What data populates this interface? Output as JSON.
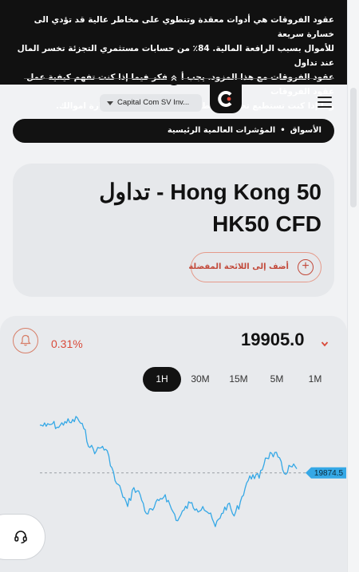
{
  "risk_warning": {
    "lines": [
      "عقود الفروقات هي أدوات معقدة وتنطوي على مخاطر عالية قد تؤدي الى خسارة سريعة",
      "للأموال بسبب الرافعة المالية. 84٪ من حسابات مستثمري التجزئة تخسر المال عند تداول",
      "عقود الفروقات مع هذا المزود. يجب أن تفكر فيما إذا كنت تفهم كيفية عمل عقود الفروقات",
      "وما إذا كنت تستطيع تحمل مخاطر عالية قد تؤدي الى خسارة اموالك."
    ],
    "collapse_icon": "double-chevron-up-icon"
  },
  "header": {
    "account_label": "Capital Com SV Inv...",
    "logo_icon": "capital-com-logo",
    "menu_icon": "hamburger-menu-icon"
  },
  "breadcrumb": {
    "items": [
      "الأسواق",
      "المؤشرات العالمية الرئيسية"
    ],
    "separator": "•"
  },
  "instrument": {
    "title_line1": "تداول - Hong Kong 50",
    "title_line2": "HK50 CFD",
    "favorite_label": "أضف إلى اللائحة المفضلة"
  },
  "quote": {
    "price": "19905.0",
    "change": "0.31%",
    "timeframes": [
      "1H",
      "30M",
      "15M",
      "5M",
      "1M"
    ],
    "active_timeframe": "1H",
    "colors": {
      "down": "#d94a3a",
      "line": "#35a8e6",
      "accent": "#c2493a"
    }
  },
  "chart_data": {
    "type": "line",
    "reference_label": "19874.5",
    "series": [
      {
        "values": [
          19915,
          19914,
          19916,
          19913,
          19918,
          19917,
          19921,
          19912,
          19896,
          19893,
          19897,
          19889,
          19868,
          19859,
          19846,
          19862,
          19856,
          19840,
          19843,
          19851,
          19856,
          19844,
          19834,
          19843,
          19849,
          19844,
          19846,
          19840,
          19829,
          19840,
          19848,
          19838,
          19850,
          19866,
          19873,
          19870,
          19887,
          19891,
          19888,
          19874,
          19880,
          19878
        ]
      }
    ]
  }
}
